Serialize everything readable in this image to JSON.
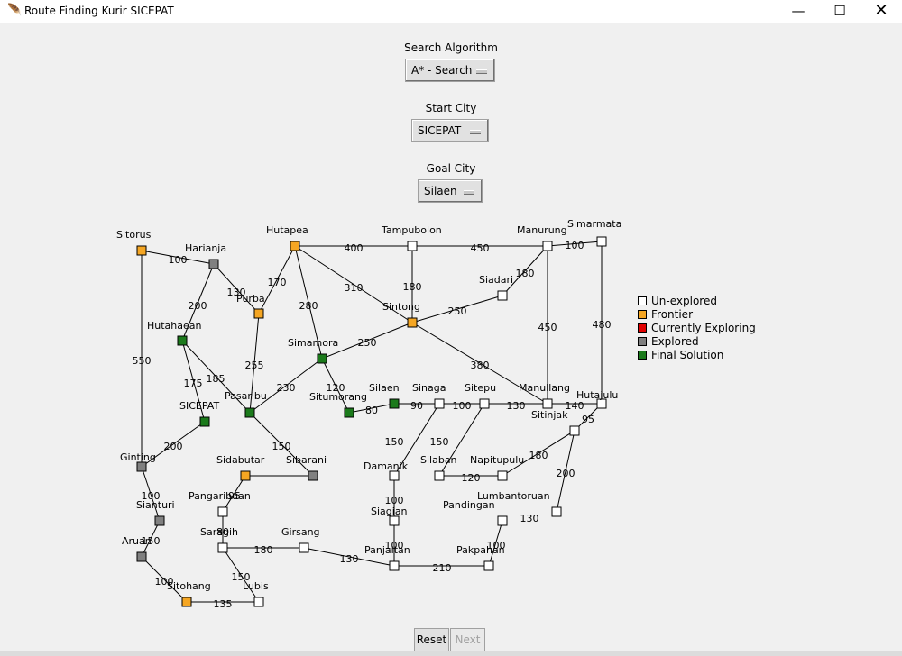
{
  "window": {
    "title": "Route Finding Kurir SICEPAT",
    "minimize": "—",
    "maximize": "☐",
    "close": "✕"
  },
  "controls": {
    "algorithm": {
      "label": "Search Algorithm",
      "value": "A* - Search"
    },
    "start": {
      "label": "Start City",
      "value": "SICEPAT"
    },
    "goal": {
      "label": "Goal City",
      "value": "Silaen"
    }
  },
  "colors": {
    "unexplored": "#ffffff",
    "frontier": "#f5a623",
    "exploring": "#e00000",
    "explored": "#808080",
    "solution": "#1b7a1b",
    "edge": "#000000"
  },
  "legend": [
    {
      "label": "Un-explored",
      "state": "unexplored"
    },
    {
      "label": "Frontier",
      "state": "frontier"
    },
    {
      "label": "Currently Exploring",
      "state": "exploring"
    },
    {
      "label": "Explored",
      "state": "explored"
    },
    {
      "label": "Final Solution",
      "state": "solution"
    }
  ],
  "cities": [
    {
      "name": "Sitorus",
      "state": "frontier"
    },
    {
      "name": "Harianja",
      "state": "explored"
    },
    {
      "name": "Hutapea",
      "state": "frontier"
    },
    {
      "name": "Purba",
      "state": "frontier"
    },
    {
      "name": "Hutahaean",
      "state": "solution"
    },
    {
      "name": "Tampubolon",
      "state": "unexplored"
    },
    {
      "name": "Manurung",
      "state": "unexplored"
    },
    {
      "name": "Simarmata",
      "state": "unexplored"
    },
    {
      "name": "Siadari",
      "state": "unexplored"
    },
    {
      "name": "Sintong",
      "state": "frontier"
    },
    {
      "name": "Simamora",
      "state": "solution"
    },
    {
      "name": "Pasaribu",
      "state": "solution"
    },
    {
      "name": "SICEPAT",
      "state": "solution"
    },
    {
      "name": "Situmorang",
      "state": "solution"
    },
    {
      "name": "Silaen",
      "state": "solution"
    },
    {
      "name": "Sinaga",
      "state": "unexplored"
    },
    {
      "name": "Sitepu",
      "state": "unexplored"
    },
    {
      "name": "Manullang",
      "state": "unexplored"
    },
    {
      "name": "Sitinjak",
      "state": "unexplored"
    },
    {
      "name": "Hutajulu",
      "state": "unexplored"
    },
    {
      "name": "Ginting",
      "state": "explored"
    },
    {
      "name": "Sidabutar",
      "state": "frontier"
    },
    {
      "name": "Sibarani",
      "state": "explored"
    },
    {
      "name": "Damanik",
      "state": "unexplored"
    },
    {
      "name": "Silaban",
      "state": "unexplored"
    },
    {
      "name": "Napitupulu",
      "state": "unexplored"
    },
    {
      "name": "Sianturi",
      "state": "explored"
    },
    {
      "name": "Pangaribuan",
      "state": "unexplored"
    },
    {
      "name": "Lumbantoruan",
      "state": "unexplored"
    },
    {
      "name": "Pandingan",
      "state": "unexplored"
    },
    {
      "name": "Siagian",
      "state": "unexplored"
    },
    {
      "name": "Aruan",
      "state": "explored"
    },
    {
      "name": "Saragih",
      "state": "unexplored"
    },
    {
      "name": "Girsang",
      "state": "unexplored"
    },
    {
      "name": "Panjaitan",
      "state": "unexplored"
    },
    {
      "name": "Pakpahan",
      "state": "unexplored"
    },
    {
      "name": "Sitohang",
      "state": "frontier"
    },
    {
      "name": "Lubis",
      "state": "unexplored"
    }
  ],
  "roads": [
    {
      "from": "Sitorus",
      "to": "Ginting",
      "distance": "550"
    },
    {
      "from": "Sitorus",
      "to": "Harianja",
      "distance": "100"
    },
    {
      "from": "Harianja",
      "to": "Purba",
      "distance": "130"
    },
    {
      "from": "Harianja",
      "to": "Hutahaean",
      "distance": "200"
    },
    {
      "from": "Hutapea",
      "to": "Purba",
      "distance": "170"
    },
    {
      "from": "Hutapea",
      "to": "Tampubolon",
      "distance": "400"
    },
    {
      "from": "Hutapea",
      "to": "Simamora",
      "distance": "280"
    },
    {
      "from": "Hutapea",
      "to": "Sintong",
      "distance": "310"
    },
    {
      "from": "Purba",
      "to": "Pasaribu",
      "distance": "255"
    },
    {
      "from": "Tampubolon",
      "to": "Manurung",
      "distance": "450"
    },
    {
      "from": "Tampubolon",
      "to": "Sintong",
      "distance": "180"
    },
    {
      "from": "Manurung",
      "to": "Simarmata",
      "distance": "100"
    },
    {
      "from": "Manurung",
      "to": "Siadari",
      "distance": "180"
    },
    {
      "from": "Manurung",
      "to": "Sitinjak",
      "distance": "450"
    },
    {
      "from": "Simarmata",
      "to": "Hutajulu",
      "distance": "480"
    },
    {
      "from": "Siadari",
      "to": "Sintong",
      "distance": "250"
    },
    {
      "from": "Sintong",
      "to": "Simamora",
      "distance": "250"
    },
    {
      "from": "Sintong",
      "to": "Sitinjak",
      "distance": "380"
    },
    {
      "from": "Hutahaean",
      "to": "Pasaribu",
      "distance": "185"
    },
    {
      "from": "Hutahaean",
      "to": "SICEPAT",
      "distance": "175"
    },
    {
      "from": "Simamora",
      "to": "Pasaribu",
      "distance": "230"
    },
    {
      "from": "Simamora",
      "to": "Situmorang",
      "distance": "120"
    },
    {
      "from": "Pasaribu",
      "to": "Sibarani",
      "distance": "150"
    },
    {
      "from": "SICEPAT",
      "to": "Ginting",
      "distance": "200"
    },
    {
      "from": "Situmorang",
      "to": "Silaen",
      "distance": "80"
    },
    {
      "from": "Silaen",
      "to": "Sinaga",
      "distance": "90"
    },
    {
      "from": "Sinaga",
      "to": "Sitepu",
      "distance": "100"
    },
    {
      "from": "Sitepu",
      "to": "Manullang",
      "distance": "130"
    },
    {
      "from": "Manullang",
      "to": "Hutajulu",
      "distance": "140"
    },
    {
      "from": "Hutajulu",
      "to": "Lumbantoruan",
      "distance": "95"
    },
    {
      "from": "Sinaga",
      "to": "Damanik",
      "distance": "150"
    },
    {
      "from": "Sitepu",
      "to": "Silaban",
      "distance": "150"
    },
    {
      "from": "Silaban",
      "to": "Napitupulu",
      "distance": "120"
    },
    {
      "from": "Napitupulu",
      "to": "Lumbantoruan",
      "distance": "180"
    },
    {
      "from": "Lumbantoruan",
      "to": "Pandingan",
      "distance": "200"
    },
    {
      "from": "Pandingan",
      "to": "Pakpahan",
      "distance": "130"
    },
    {
      "from": "Pakpahan",
      "to": "Panjaitan",
      "distance": "100"
    },
    {
      "from": "Panjaitan",
      "to": "Siagian",
      "distance": "100"
    },
    {
      "from": "Siagian",
      "to": "Damanik",
      "distance": "100"
    },
    {
      "from": "Panjaitan",
      "to": "Girsang",
      "distance": "210"
    },
    {
      "from": "Girsang",
      "to": "Saragih",
      "distance": "130"
    },
    {
      "from": "Saragih",
      "to": "Pangaribuan",
      "distance": "180"
    },
    {
      "from": "Pangaribuan",
      "to": "Sidabutar",
      "distance": "80"
    },
    {
      "from": "Sidabutar",
      "to": "Sibarani",
      "distance": "95"
    },
    {
      "from": "Sianturi",
      "to": "Ginting",
      "distance": "100"
    },
    {
      "from": "Sianturi",
      "to": "Aruan",
      "distance": "150"
    },
    {
      "from": "Aruan",
      "to": "Sitohang",
      "distance": "100"
    },
    {
      "from": "Sitohang",
      "to": "Lubis",
      "distance": "135"
    },
    {
      "from": "Saragih",
      "to": "Lubis",
      "distance": "150"
    }
  ],
  "buttons": {
    "reset": "Reset",
    "next": "Next"
  }
}
